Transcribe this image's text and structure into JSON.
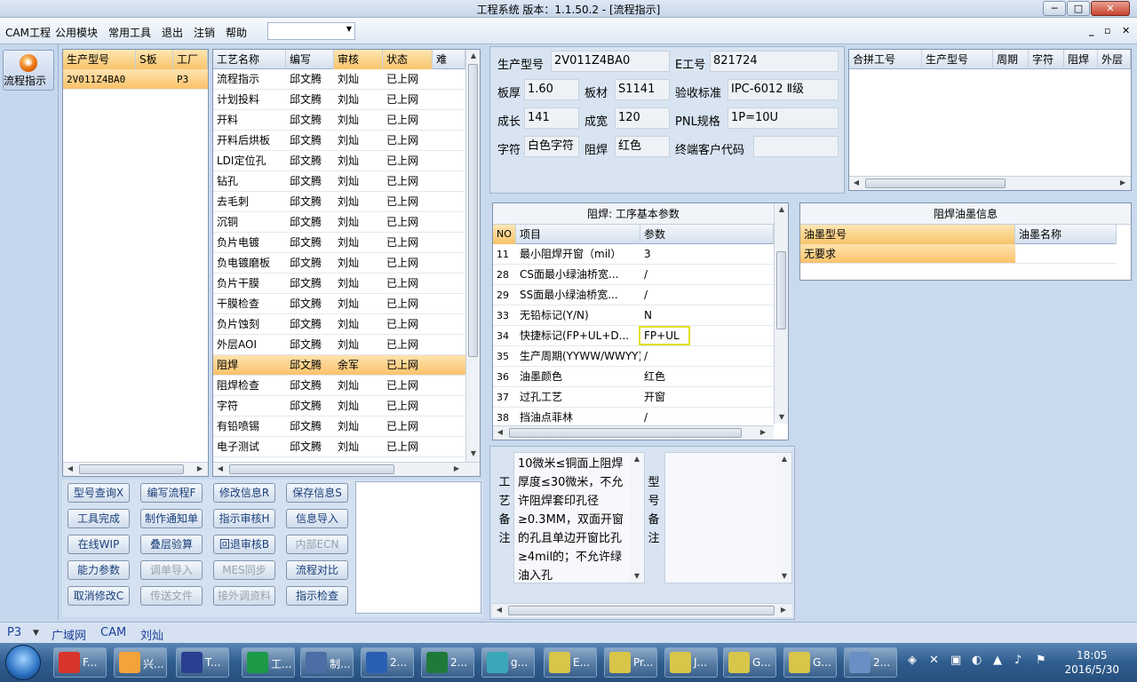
{
  "window": {
    "title": "工程系统   版本：1.1.50.2 - [流程指示]",
    "min_label": "─",
    "max_label": "□",
    "close_label": "✕"
  },
  "menu": {
    "items": [
      "CAM工程",
      "公用模块",
      "常用工具",
      "退出",
      "注销",
      "帮助"
    ],
    "dropdown_value": ""
  },
  "mdi": {
    "min": "_",
    "restore": "▫",
    "close": "✕"
  },
  "nav": {
    "label": "流程指示"
  },
  "product_grid": {
    "headers": [
      "生产型号",
      "S板",
      "工厂"
    ],
    "rows": [
      [
        "2V011Z4BA0",
        "",
        "P3"
      ]
    ]
  },
  "process_grid": {
    "headers": [
      "工艺名称",
      "编写",
      "审核",
      "状态",
      "难"
    ],
    "rows": [
      [
        "流程指示",
        "邱文腾",
        "刘灿",
        "已上网"
      ],
      [
        "计划投料",
        "邱文腾",
        "刘灿",
        "已上网"
      ],
      [
        "开料",
        "邱文腾",
        "刘灿",
        "已上网"
      ],
      [
        "开料后烘板",
        "邱文腾",
        "刘灿",
        "已上网"
      ],
      [
        "LDI定位孔",
        "邱文腾",
        "刘灿",
        "已上网"
      ],
      [
        "钻孔",
        "邱文腾",
        "刘灿",
        "已上网"
      ],
      [
        "去毛刺",
        "邱文腾",
        "刘灿",
        "已上网"
      ],
      [
        "沉铜",
        "邱文腾",
        "刘灿",
        "已上网"
      ],
      [
        "负片电镀",
        "邱文腾",
        "刘灿",
        "已上网"
      ],
      [
        "负电镀磨板",
        "邱文腾",
        "刘灿",
        "已上网"
      ],
      [
        "负片干膜",
        "邱文腾",
        "刘灿",
        "已上网"
      ],
      [
        "干膜检查",
        "邱文腾",
        "刘灿",
        "已上网"
      ],
      [
        "负片蚀刻",
        "邱文腾",
        "刘灿",
        "已上网"
      ],
      [
        "外层AOI",
        "邱文腾",
        "刘灿",
        "已上网"
      ],
      [
        "阻焊",
        "邱文腾",
        "余军",
        "已上网"
      ],
      [
        "阻焊检查",
        "邱文腾",
        "刘灿",
        "已上网"
      ],
      [
        "字符",
        "邱文腾",
        "刘灿",
        "已上网"
      ],
      [
        "有铅喷锡",
        "邱文腾",
        "刘灿",
        "已上网"
      ],
      [
        "电子测试",
        "邱文腾",
        "刘灿",
        "已上网"
      ]
    ],
    "selected_index": 14
  },
  "buttons": [
    [
      {
        "label": "型号查询X",
        "enabled": true
      },
      {
        "label": "编写流程F",
        "enabled": true
      },
      {
        "label": "修改信息R",
        "enabled": true
      },
      {
        "label": "保存信息S",
        "enabled": true
      }
    ],
    [
      {
        "label": "工具完成",
        "enabled": true
      },
      {
        "label": "制作通知单",
        "enabled": true
      },
      {
        "label": "指示审核H",
        "enabled": true
      },
      {
        "label": "信息导入",
        "enabled": true
      }
    ],
    [
      {
        "label": "在线WIP",
        "enabled": true
      },
      {
        "label": "叠层验算",
        "enabled": true
      },
      {
        "label": "回退审核B",
        "enabled": true
      },
      {
        "label": "内部ECN",
        "enabled": false
      }
    ],
    [
      {
        "label": "能力参数",
        "enabled": true
      },
      {
        "label": "调单导入",
        "enabled": false
      },
      {
        "label": "MES同步",
        "enabled": false
      },
      {
        "label": "流程对比",
        "enabled": true
      }
    ],
    [
      {
        "label": "取消修改C",
        "enabled": true
      },
      {
        "label": "传送文件",
        "enabled": false
      },
      {
        "label": "接外调资料",
        "enabled": false
      },
      {
        "label": "指示检查",
        "enabled": true
      }
    ]
  ],
  "info": {
    "product_no_label": "生产型号",
    "product_no": "2V011Z4BA0",
    "e_no_label": "E工号",
    "e_no": "821724",
    "thickness_label": "板厚",
    "thickness": "1.60",
    "material_label": "板材",
    "material": "S1141",
    "standard_label": "验收标准",
    "standard": "IPC-6012 Ⅱ级",
    "length_label": "成长",
    "length": "141",
    "width_label": "成宽",
    "width": "120",
    "pnl_label": "PNL规格",
    "pnl": "1P=10U",
    "char_label": "字符",
    "char": "白色字符",
    "mask_label": "阻焊",
    "mask": "红色",
    "customer_label": "终端客户代码",
    "customer": ""
  },
  "combine_grid": {
    "headers": [
      "合拼工号",
      "生产型号",
      "周期",
      "字符",
      "阻焊",
      "外层"
    ]
  },
  "params": {
    "title": "阻焊: 工序基本参数",
    "headers": [
      "NO",
      "项目",
      "参数"
    ],
    "rows": [
      [
        "11",
        "最小阻焊开窗（mil）",
        "3"
      ],
      [
        "28",
        "CS面最小绿油桥宽...",
        "/"
      ],
      [
        "29",
        "SS面最小绿油桥宽...",
        "/"
      ],
      [
        "33",
        "无铅标记(Y/N)",
        "N"
      ],
      [
        "34",
        "快捷标记(FP+UL+D...",
        "FP+UL"
      ],
      [
        "35",
        "生产周期(YYWW/WWYY)",
        "/"
      ],
      [
        "36",
        "油墨颜色",
        "红色"
      ],
      [
        "37",
        "过孔工艺",
        "开窗"
      ],
      [
        "38",
        "挡油点菲林",
        "/"
      ]
    ]
  },
  "ink": {
    "title": "阻焊油墨信息",
    "headers": [
      "油墨型号",
      "油墨名称"
    ],
    "rows": [
      [
        "无要求",
        ""
      ]
    ]
  },
  "remarks": {
    "process_label": [
      "工",
      "艺",
      "备",
      "注"
    ],
    "process_text": "10微米≤铜面上阻焊厚度≤30微米，不允许阻焊套印孔径≥0.3MM，双面开窗的孔且单边开窗比孔≥4mil的；不允许绿油入孔",
    "model_label": [
      "型",
      "号",
      "备",
      "注"
    ]
  },
  "status": {
    "factory": "P3",
    "items": [
      "广域网",
      "CAM",
      "刘灿"
    ]
  },
  "taskbar": {
    "tasks": [
      {
        "label": "F...",
        "color": "#d8342b"
      },
      {
        "label": "兴...",
        "color": "#f2a33a"
      },
      {
        "label": "T...",
        "color": "#2a3f8f"
      },
      {
        "label": "工...",
        "color": "#1c9a46"
      },
      {
        "label": "制...",
        "color": "#4b6ea6"
      },
      {
        "label": "2...",
        "color": "#2b5fb3"
      },
      {
        "label": "2...",
        "color": "#1f7a3a"
      },
      {
        "label": "g...",
        "color": "#3aa6b8"
      },
      {
        "label": "E...",
        "color": "#d8c64a"
      },
      {
        "label": "Pr...",
        "color": "#d8c64a"
      },
      {
        "label": "J...",
        "color": "#d8c64a"
      },
      {
        "label": "G...",
        "color": "#d8c64a"
      },
      {
        "label": "G...",
        "color": "#d8c64a"
      },
      {
        "label": "2...",
        "color": "#6a8fc4"
      }
    ],
    "time": "18:05",
    "date": "2016/5/30"
  }
}
